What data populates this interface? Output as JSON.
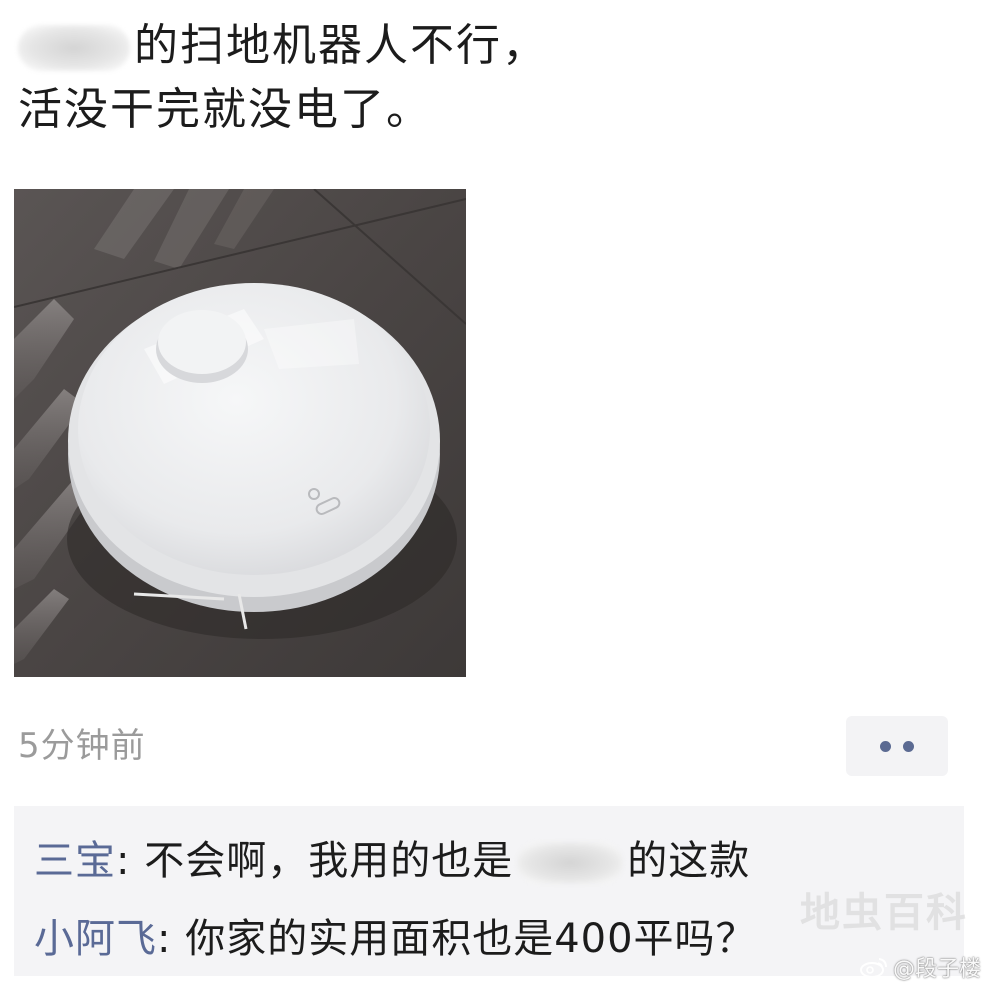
{
  "post": {
    "line1_suffix": "的扫地机器人不行，",
    "line2": "活没干完就没电了。"
  },
  "timestamp": "5分钟前",
  "comments": [
    {
      "author": "三宝",
      "separator": ": ",
      "text_before_blur": "不会啊，我用的也是",
      "text_after_blur": "的这款"
    },
    {
      "author": "小阿飞",
      "separator": ": ",
      "text": "你家的实用面积也是400平吗？"
    }
  ],
  "watermark": {
    "handle": "@段子楼",
    "logo": "地虫百科"
  },
  "colors": {
    "author": "#5a6a96",
    "more_dots": "#5b6a92",
    "comment_bg": "#f4f4f6",
    "timestamp": "#9b9b9b"
  },
  "icons": {
    "more": "more-dots-icon",
    "weibo": "weibo-icon"
  }
}
